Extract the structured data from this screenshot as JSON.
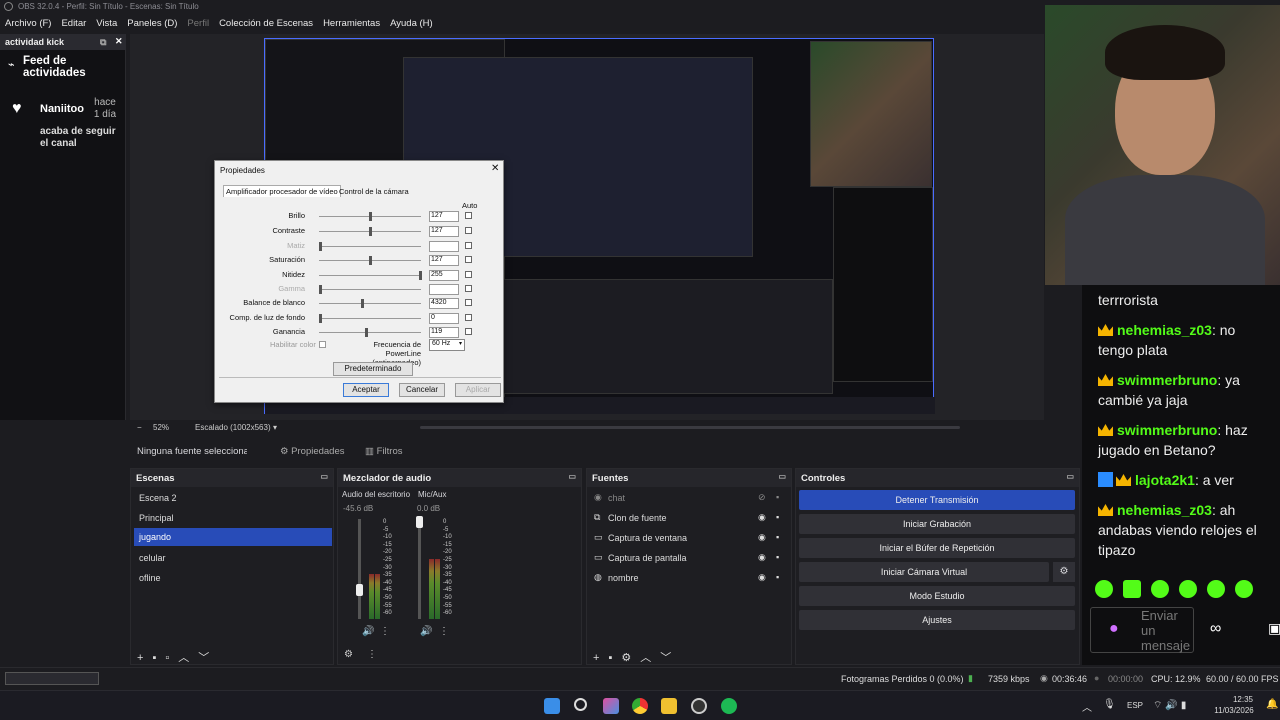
{
  "window": {
    "title": "OBS 32.0.4 - Perfil: Sin Título - Escenas: Sin Título"
  },
  "menu": [
    "Archivo (F)",
    "Editar",
    "Vista",
    "Paneles (D)",
    "Perfil",
    "Colección de Escenas",
    "Herramientas",
    "Ayuda (H)"
  ],
  "dock": {
    "title": "actividad kick",
    "header": "Feed de actividades",
    "item_user": "Naniitoo",
    "item_time": "hace 1 día",
    "item_text": "acaba de seguir el canal"
  },
  "dialog": {
    "title": "Propiedades",
    "tab1": "Amplificador procesador de vídeo",
    "tab2": "Control de la cámara",
    "auto": "Auto",
    "rows": [
      {
        "label": "Brillo",
        "value": "127",
        "pos": 0.5
      },
      {
        "label": "Contraste",
        "value": "127",
        "pos": 0.5
      },
      {
        "label": "Matiz",
        "value": "",
        "pos": 0.0
      },
      {
        "label": "Saturación",
        "value": "127",
        "pos": 0.5
      },
      {
        "label": "Nitidez",
        "value": "255",
        "pos": 1.0
      },
      {
        "label": "Gamma",
        "value": "",
        "pos": 0.0
      },
      {
        "label": "Balance de blanco",
        "value": "4320",
        "pos": 0.42
      },
      {
        "label": "Comp. de luz de fondo",
        "value": "0",
        "pos": 0.0
      },
      {
        "label": "Ganancia",
        "value": "119",
        "pos": 0.46
      }
    ],
    "enable_color": "Habilitar color",
    "powerline_label": "Frecuencia de PowerLine (antiparpadeo)",
    "powerline_value": "60 Hz",
    "default_btn": "Predeterminado",
    "ok": "Aceptar",
    "cancel": "Cancelar",
    "apply": "Aplicar"
  },
  "zoom": {
    "minus": "−",
    "percent": "52%",
    "scale": "Escalado (1002x563)"
  },
  "source_bar": {
    "no_source": "Ninguna fuente seleccionada",
    "props": "Propiedades",
    "filters": "Filtros"
  },
  "scenes": {
    "title": "Escenas",
    "items": [
      "Escena 2",
      "Principal",
      "jugando",
      "celular",
      "ofline"
    ],
    "selected": 2
  },
  "mixer": {
    "title": "Mezclador de audio",
    "channels": [
      {
        "name": "Audio del escritorio",
        "db": "-45.6 dB",
        "level": 0.45,
        "vol": 0.3
      },
      {
        "name": "Mic/Aux",
        "db": "0.0 dB",
        "level": 0.6,
        "vol": 0.98
      }
    ],
    "scale": [
      "0",
      "-5",
      "-10",
      "-15",
      "-20",
      "-25",
      "-30",
      "-35",
      "-40",
      "-45",
      "-50",
      "-55",
      "-60"
    ]
  },
  "sources": {
    "title": "Fuentes",
    "items": [
      "chat",
      "Clon de fuente",
      "Captura de ventana",
      "Captura de pantalla",
      "nombre"
    ]
  },
  "controls": {
    "title": "Controles",
    "stop_stream": "Detener Transmisión",
    "start_rec": "Iniciar Grabación",
    "replay": "Iniciar el Búfer de Repetición",
    "vcam": "Iniciar Cámara Virtual",
    "studio": "Modo Estudio",
    "settings": "Ajustes"
  },
  "chat": {
    "messages": [
      {
        "user": "",
        "text": "terrrorista",
        "badge": ""
      },
      {
        "user": "nehemias_z03",
        "text": "no tengo plata",
        "badge": "crown"
      },
      {
        "user": "swimmerbruno",
        "text": "ya cambié ya jaja",
        "badge": "crown"
      },
      {
        "user": "swimmerbruno",
        "text": "haz jugado en Betano?",
        "badge": "crown"
      },
      {
        "user": "lajota2k1",
        "text": "a ver",
        "badge": "both"
      },
      {
        "user": "nehemias_z03",
        "text": "ah andabas viendo relojes el tipazo",
        "badge": "crown"
      }
    ],
    "send_placeholder": "Enviar un mensaje"
  },
  "status": {
    "dropped": "Fotogramas Perdidos 0 (0.0%)",
    "kbps": "7359 kbps",
    "stream_time": "00:36:46",
    "rec_time": "00:00:00",
    "cpu": "CPU: 12.9%",
    "fps": "60.00 / 60.00 FPS"
  },
  "taskbar": {
    "lang": "ESP",
    "time": "12:35",
    "date": "11/03/2026"
  }
}
